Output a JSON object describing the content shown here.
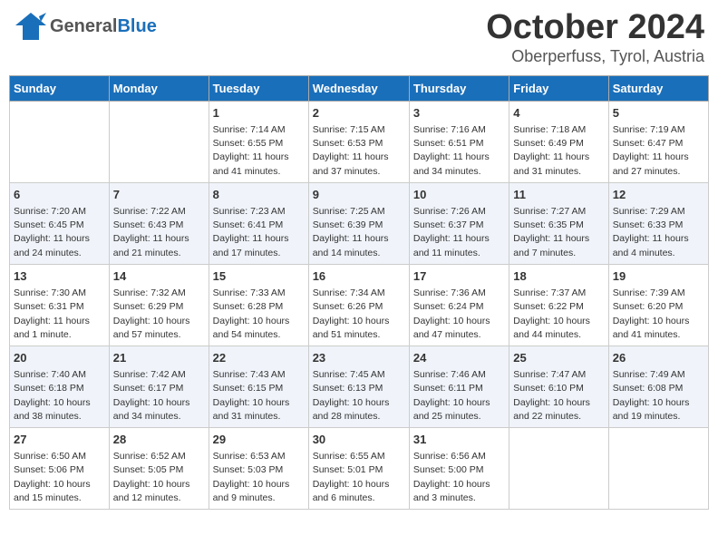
{
  "header": {
    "logo_general": "General",
    "logo_blue": "Blue",
    "month": "October 2024",
    "location": "Oberperfuss, Tyrol, Austria"
  },
  "days_of_week": [
    "Sunday",
    "Monday",
    "Tuesday",
    "Wednesday",
    "Thursday",
    "Friday",
    "Saturday"
  ],
  "weeks": [
    {
      "id": "week1",
      "cells": [
        {
          "day": "",
          "info": ""
        },
        {
          "day": "",
          "info": ""
        },
        {
          "day": "1",
          "info": "Sunrise: 7:14 AM\nSunset: 6:55 PM\nDaylight: 11 hours and 41 minutes."
        },
        {
          "day": "2",
          "info": "Sunrise: 7:15 AM\nSunset: 6:53 PM\nDaylight: 11 hours and 37 minutes."
        },
        {
          "day": "3",
          "info": "Sunrise: 7:16 AM\nSunset: 6:51 PM\nDaylight: 11 hours and 34 minutes."
        },
        {
          "day": "4",
          "info": "Sunrise: 7:18 AM\nSunset: 6:49 PM\nDaylight: 11 hours and 31 minutes."
        },
        {
          "day": "5",
          "info": "Sunrise: 7:19 AM\nSunset: 6:47 PM\nDaylight: 11 hours and 27 minutes."
        }
      ]
    },
    {
      "id": "week2",
      "cells": [
        {
          "day": "6",
          "info": "Sunrise: 7:20 AM\nSunset: 6:45 PM\nDaylight: 11 hours and 24 minutes."
        },
        {
          "day": "7",
          "info": "Sunrise: 7:22 AM\nSunset: 6:43 PM\nDaylight: 11 hours and 21 minutes."
        },
        {
          "day": "8",
          "info": "Sunrise: 7:23 AM\nSunset: 6:41 PM\nDaylight: 11 hours and 17 minutes."
        },
        {
          "day": "9",
          "info": "Sunrise: 7:25 AM\nSunset: 6:39 PM\nDaylight: 11 hours and 14 minutes."
        },
        {
          "day": "10",
          "info": "Sunrise: 7:26 AM\nSunset: 6:37 PM\nDaylight: 11 hours and 11 minutes."
        },
        {
          "day": "11",
          "info": "Sunrise: 7:27 AM\nSunset: 6:35 PM\nDaylight: 11 hours and 7 minutes."
        },
        {
          "day": "12",
          "info": "Sunrise: 7:29 AM\nSunset: 6:33 PM\nDaylight: 11 hours and 4 minutes."
        }
      ]
    },
    {
      "id": "week3",
      "cells": [
        {
          "day": "13",
          "info": "Sunrise: 7:30 AM\nSunset: 6:31 PM\nDaylight: 11 hours and 1 minute."
        },
        {
          "day": "14",
          "info": "Sunrise: 7:32 AM\nSunset: 6:29 PM\nDaylight: 10 hours and 57 minutes."
        },
        {
          "day": "15",
          "info": "Sunrise: 7:33 AM\nSunset: 6:28 PM\nDaylight: 10 hours and 54 minutes."
        },
        {
          "day": "16",
          "info": "Sunrise: 7:34 AM\nSunset: 6:26 PM\nDaylight: 10 hours and 51 minutes."
        },
        {
          "day": "17",
          "info": "Sunrise: 7:36 AM\nSunset: 6:24 PM\nDaylight: 10 hours and 47 minutes."
        },
        {
          "day": "18",
          "info": "Sunrise: 7:37 AM\nSunset: 6:22 PM\nDaylight: 10 hours and 44 minutes."
        },
        {
          "day": "19",
          "info": "Sunrise: 7:39 AM\nSunset: 6:20 PM\nDaylight: 10 hours and 41 minutes."
        }
      ]
    },
    {
      "id": "week4",
      "cells": [
        {
          "day": "20",
          "info": "Sunrise: 7:40 AM\nSunset: 6:18 PM\nDaylight: 10 hours and 38 minutes."
        },
        {
          "day": "21",
          "info": "Sunrise: 7:42 AM\nSunset: 6:17 PM\nDaylight: 10 hours and 34 minutes."
        },
        {
          "day": "22",
          "info": "Sunrise: 7:43 AM\nSunset: 6:15 PM\nDaylight: 10 hours and 31 minutes."
        },
        {
          "day": "23",
          "info": "Sunrise: 7:45 AM\nSunset: 6:13 PM\nDaylight: 10 hours and 28 minutes."
        },
        {
          "day": "24",
          "info": "Sunrise: 7:46 AM\nSunset: 6:11 PM\nDaylight: 10 hours and 25 minutes."
        },
        {
          "day": "25",
          "info": "Sunrise: 7:47 AM\nSunset: 6:10 PM\nDaylight: 10 hours and 22 minutes."
        },
        {
          "day": "26",
          "info": "Sunrise: 7:49 AM\nSunset: 6:08 PM\nDaylight: 10 hours and 19 minutes."
        }
      ]
    },
    {
      "id": "week5",
      "cells": [
        {
          "day": "27",
          "info": "Sunrise: 6:50 AM\nSunset: 5:06 PM\nDaylight: 10 hours and 15 minutes."
        },
        {
          "day": "28",
          "info": "Sunrise: 6:52 AM\nSunset: 5:05 PM\nDaylight: 10 hours and 12 minutes."
        },
        {
          "day": "29",
          "info": "Sunrise: 6:53 AM\nSunset: 5:03 PM\nDaylight: 10 hours and 9 minutes."
        },
        {
          "day": "30",
          "info": "Sunrise: 6:55 AM\nSunset: 5:01 PM\nDaylight: 10 hours and 6 minutes."
        },
        {
          "day": "31",
          "info": "Sunrise: 6:56 AM\nSunset: 5:00 PM\nDaylight: 10 hours and 3 minutes."
        },
        {
          "day": "",
          "info": ""
        },
        {
          "day": "",
          "info": ""
        }
      ]
    }
  ]
}
